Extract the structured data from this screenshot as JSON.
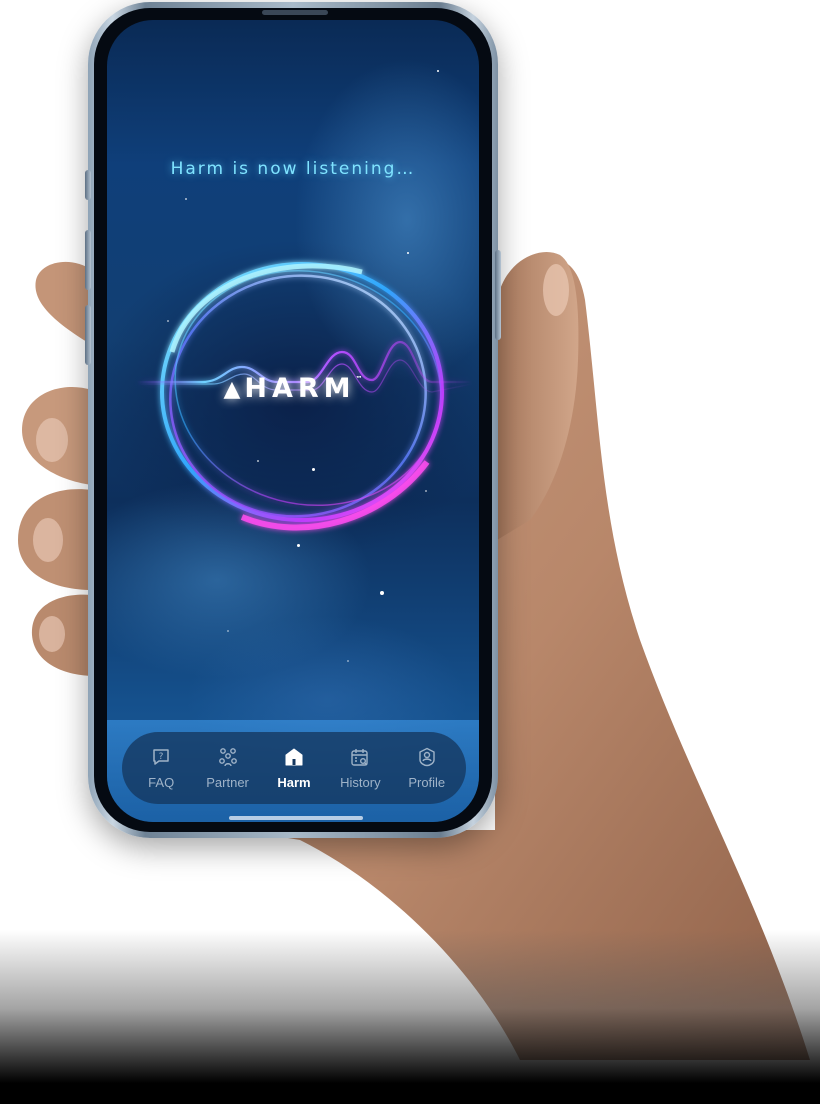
{
  "status_text": "Harm is now listening…",
  "logo": {
    "text": "HARM",
    "trademark": "™",
    "mark_icon": "triangle-logo-icon"
  },
  "nav": {
    "items": [
      {
        "label": "FAQ",
        "icon": "faq-bubble-icon",
        "active": false
      },
      {
        "label": "Partner",
        "icon": "partner-people-icon",
        "active": false
      },
      {
        "label": "Harm",
        "icon": "home-icon",
        "active": true
      },
      {
        "label": "History",
        "icon": "calendar-search-icon",
        "active": false
      },
      {
        "label": "Profile",
        "icon": "user-badge-icon",
        "active": false
      }
    ]
  },
  "colors": {
    "accent_cyan": "#7fe3ff",
    "accent_magenta": "#c13cff",
    "nav_active": "#ffffff",
    "nav_inactive": "#9fb3c8"
  }
}
